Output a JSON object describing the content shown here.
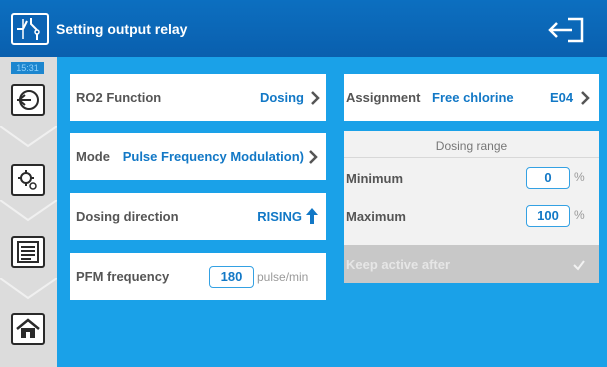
{
  "header": {
    "title": "Setting output relay",
    "app_icon": "relay-switch-icon",
    "exit_icon": "exit-door-icon"
  },
  "sidebar": {
    "time": "15:31",
    "buttons": [
      {
        "icon": "back-arrow-icon"
      },
      {
        "icon": "settings-gear-icon"
      },
      {
        "icon": "menu-list-icon"
      },
      {
        "icon": "home-icon"
      }
    ]
  },
  "rows": {
    "function": {
      "label": "RO2 Function",
      "value": "Dosing"
    },
    "mode": {
      "label": "Mode",
      "value": "Pulse Frequency Modulation)"
    },
    "direction": {
      "label": "Dosing direction",
      "value": "RISING"
    },
    "pfm": {
      "label": "PFM frequency",
      "value": "180",
      "unit": "pulse/min"
    },
    "assignment": {
      "label": "Assignment",
      "value": "Free chlorine",
      "code": "E04"
    }
  },
  "range": {
    "title": "Dosing range",
    "minimum": {
      "label": "Minimum",
      "value": "0",
      "unit": "%"
    },
    "maximum": {
      "label": "Maximum",
      "value": "100",
      "unit": "%"
    },
    "keep_active": {
      "label": "Keep active after",
      "checked": true
    }
  },
  "colors": {
    "background": "#1aa1e8",
    "header": "#0a5fae",
    "accent": "#1278c6",
    "sidebar": "#dcdcdc"
  }
}
